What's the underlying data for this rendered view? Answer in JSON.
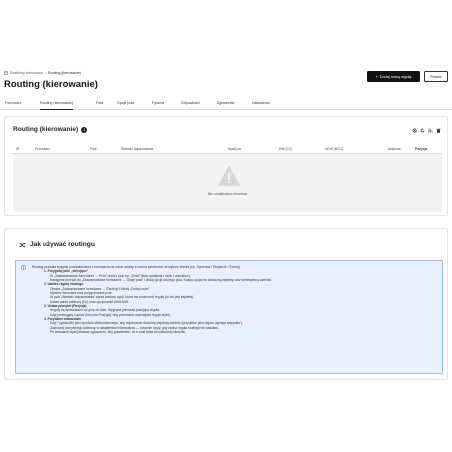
{
  "breadcrumb": {
    "home": "Szablony formularza",
    "current": "Routing (kierowanie)"
  },
  "page_title": "Routing (kierowanie)",
  "header": {
    "add_button": "Dodaj nową regułę",
    "help_button": "Pomoc"
  },
  "tabs": [
    {
      "label": "Formularz"
    },
    {
      "label": "Routing (kierowanie)"
    },
    {
      "label": "Pola"
    },
    {
      "label": "Opcje pola"
    },
    {
      "label": "Pytania"
    },
    {
      "label": "Odpowiedzi"
    },
    {
      "label": "Zgłoszenia"
    },
    {
      "label": "Ustawienia"
    }
  ],
  "routing_card": {
    "title": "Routing (kierowanie)",
    "columns": [
      "ID",
      "Formularz",
      "Pole",
      "Wartość dopasowania",
      "Wyślij do",
      "DW (CC)",
      "UDW (BCC)",
      "Aktywna",
      "Pozycja"
    ],
    "empty_text": "Nie odnaleziono rekordów"
  },
  "howto": {
    "title": "Jak używać routingu",
    "intro": "Routing pozwala wysyłać powiadomienia z formularza na różne adresy e-mail w zależności od wyboru klienta (np. Sprzedaż / Wsparcie / Zwroty).",
    "s1_title": "1. Przygotuj pole „sterujące”",
    "s1_l1": "W „Zaawansowane formularze → Pola” utwórz pole np. „Dział” (lista rozwijana / radio / checkbox).",
    "s1_l2": "Następnie przejdź do „Zaawansowane formularze → Opcje pola” i dodaj opcje dla tego pola. Każda opcja ma widoczną etykietę oraz wewnętrzną wartość.",
    "s2_title": "2. Utwórz regułę routingu",
    "s2_l1": "Otwórz „Zaawansowane formularze → Routing” i kliknij „Dodaj nowe”.",
    "s2_l2": "Wybierz formularz oraz przygotowane pole.",
    "s2_l3": "W polu „Wartość dopasowania” wpisz wartość opcji, która ma uruchomić regułę (to nie jest etykieta).",
    "s2_l4": "Ustaw adres odbiorcy (Do) oraz opcjonalnie DW/UDW.",
    "s3_title": "3. Ustaw priorytet (Pozycja)",
    "s3_l1": "Reguły są sprawdzane od góry do dołu. Wygrywa pierwsza pasująca reguła.",
    "s3_l2": "Użyj przeciągnij-i-upuść (lub pola Pozycja), aby przestawić ważniejsze reguły wyżej.",
    "s4_title": "4. Przydatne wskazówki",
    "s4_l1": "Użyj * (gwiazdki) jako symbolu wieloznacznego, aby dopasować dowolną niepustą wartość (przydatne jako reguła „łapiąca wszystko”).",
    "s4_l2": "Zachowaj domyślnego odbiorcę w ustawieniach formularza — zostanie użyty, gdy żadna reguła routingu nie zadziała.",
    "s4_l3": "Po zmianach wyślij testowe zgłoszenie, aby potwierdzić, że e-mail trafia do właściwej skrzynki."
  },
  "colors": {
    "primary_button": "#111111",
    "info_background": "#e8f0fd",
    "info_border": "#9db8ea",
    "info_icon": "#2f62c9"
  }
}
